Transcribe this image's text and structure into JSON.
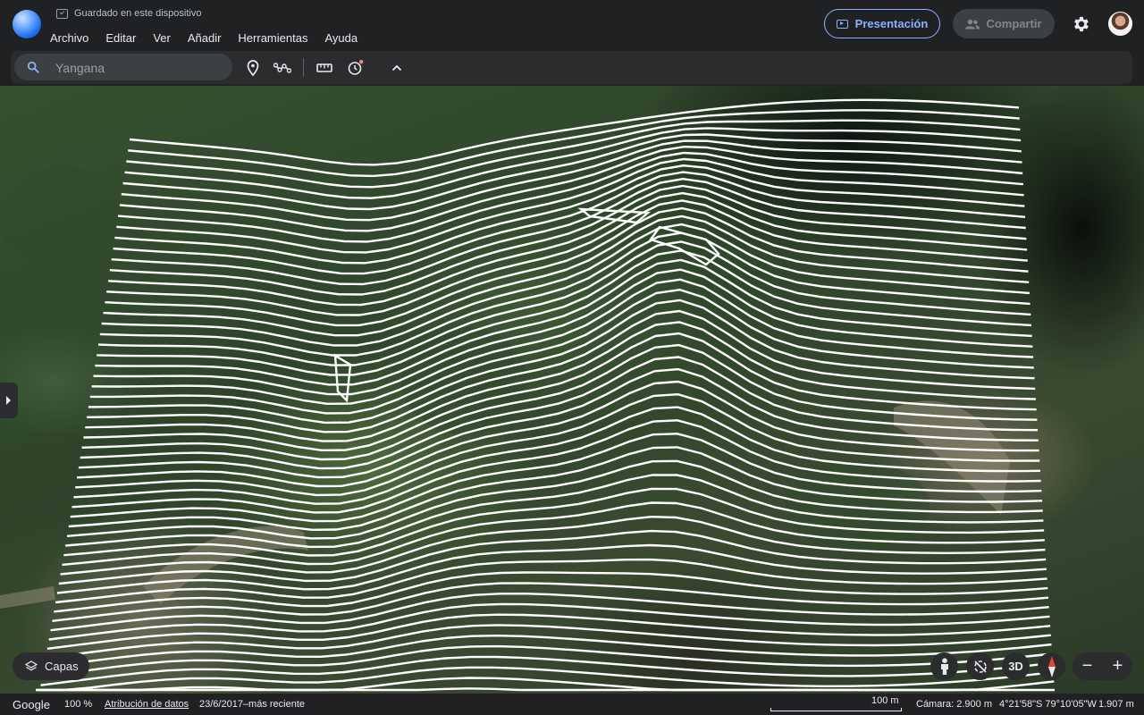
{
  "header": {
    "saved_status": "Guardado en este dispositivo",
    "menu": [
      "Archivo",
      "Editar",
      "Ver",
      "Añadir",
      "Herramientas",
      "Ayuda"
    ],
    "present_label": "Presentación",
    "share_label": "Compartir"
  },
  "search": {
    "value": "Yangana"
  },
  "map": {
    "layers_label": "Capas",
    "three_d_label": "3D",
    "zoom_out_label": "−",
    "zoom_in_label": "+"
  },
  "status": {
    "brand": "Google",
    "zoom": "100 %",
    "attribution": "Atribución de datos",
    "imagery_date": "23/6/2017–más reciente",
    "scale": "100 m",
    "camera": "Cámara: 2.900 m",
    "coordinates": "4°21'58\"S 79°10'05\"W",
    "elevation": "1.907 m"
  },
  "colors": {
    "accent": "#8ab4f8",
    "background": "#1f2123",
    "contour": "#ffffff"
  }
}
